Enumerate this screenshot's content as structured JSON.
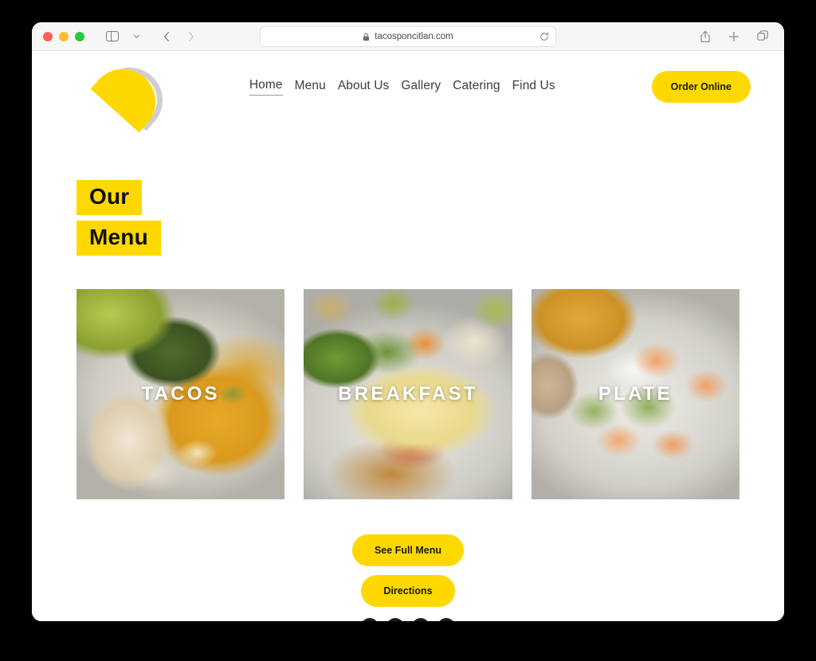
{
  "browser": {
    "url": "tacosponcitlan.com",
    "lock_icon": "lock-icon",
    "reload_icon": "reload-icon",
    "sidebar_icon": "sidebar-toggle-icon",
    "chevron_icon": "chevron-down-icon",
    "back_icon": "back-arrow-icon",
    "forward_icon": "forward-arrow-icon",
    "share_icon": "share-icon",
    "newtab_icon": "plus-icon",
    "tabs_icon": "tab-overview-icon"
  },
  "site": {
    "logo_name": "taco-logo",
    "nav": [
      {
        "label": "Home",
        "active": true
      },
      {
        "label": "Menu",
        "active": false
      },
      {
        "label": "About Us",
        "active": false
      },
      {
        "label": "Gallery",
        "active": false
      },
      {
        "label": "Catering",
        "active": false
      },
      {
        "label": "Find Us",
        "active": false
      }
    ],
    "order_button": "Order Online",
    "heading": {
      "line1": "Our",
      "line2": "Menu"
    },
    "cards": [
      {
        "label": "TACOS"
      },
      {
        "label": "BREAKFAST"
      },
      {
        "label": "PLATE"
      }
    ],
    "cta": {
      "menu_button": "See Full Menu",
      "directions_button": "Directions"
    },
    "social": [
      {
        "name": "instagram-icon"
      },
      {
        "name": "facebook-icon"
      },
      {
        "name": "yelp-icon"
      },
      {
        "name": "tripadvisor-icon"
      }
    ]
  },
  "colors": {
    "brand_yellow": "#FFD800",
    "text_dark": "#1a1a1a",
    "nav_text": "#3d3d3d"
  }
}
